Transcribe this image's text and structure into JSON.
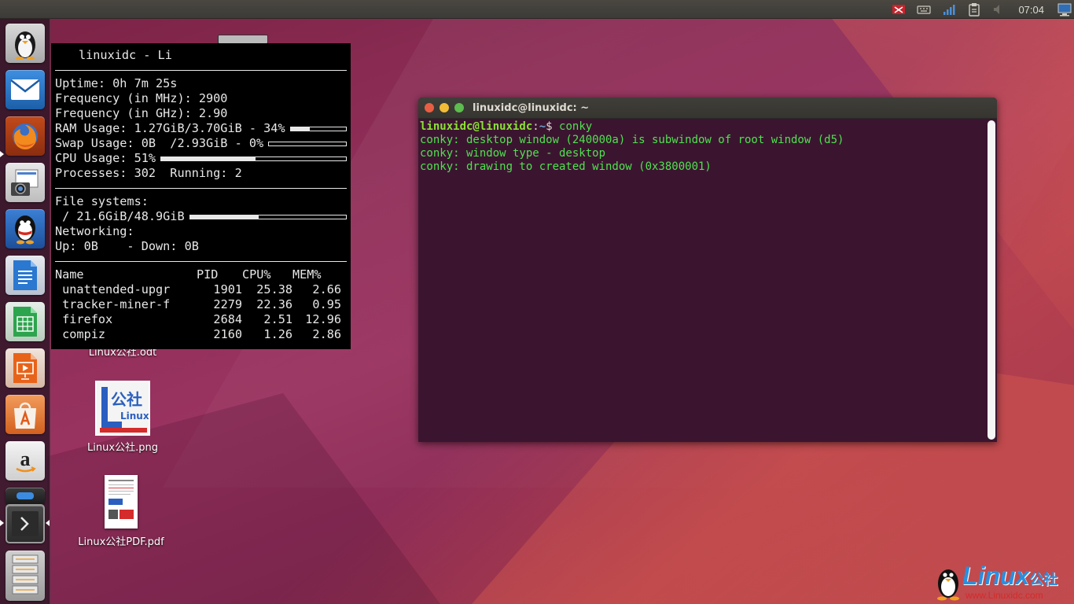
{
  "top_panel": {
    "clock": "07:04",
    "tray_icons": [
      "notification-icon",
      "keyboard-icon",
      "network-icon",
      "clipboard-icon",
      "volume-icon",
      "session-icon"
    ]
  },
  "launcher": {
    "items": [
      {
        "name": "qq-penguin",
        "label": "QQ"
      },
      {
        "name": "mail",
        "label": "Mail"
      },
      {
        "name": "firefox",
        "label": "Firefox"
      },
      {
        "name": "screenshot",
        "label": "Screenshot"
      },
      {
        "name": "qq",
        "label": "QQ"
      },
      {
        "name": "writer",
        "label": "Writer"
      },
      {
        "name": "calc",
        "label": "Calc"
      },
      {
        "name": "impress",
        "label": "Impress"
      },
      {
        "name": "software-center",
        "label": "Software"
      },
      {
        "name": "amazon",
        "label": "Amazon"
      },
      {
        "name": "drive",
        "label": "Drive"
      },
      {
        "name": "terminal",
        "label": "Terminal"
      },
      {
        "name": "workspaces",
        "label": "Workspaces"
      }
    ]
  },
  "conky": {
    "title": "linuxidc - Li",
    "uptime": "Uptime: 0h 7m 25s",
    "freq_mhz": "Frequency (in MHz): 2900",
    "freq_ghz": "Frequency (in GHz): 2.90",
    "ram": "RAM Usage: 1.27GiB/3.70GiB - 34%",
    "ram_pct": 34,
    "swap": "Swap Usage: 0B  /2.93GiB - 0%",
    "swap_pct": 0,
    "cpu": "CPU Usage: 51%",
    "cpu_pct": 51,
    "processes": "Processes: 302  Running: 2",
    "fs_header": "File systems:",
    "fs_root": " / 21.6GiB/48.9GiB",
    "fs_pct": 44,
    "net_header": "Networking:",
    "net": "Up: 0B    - Down: 0B",
    "proc_headers": [
      "Name",
      "PID",
      "CPU%",
      "MEM%"
    ],
    "procs": [
      {
        "name": " unattended-upgr",
        "pid": "1901",
        "cpu": "25.38",
        "mem": "2.66"
      },
      {
        "name": " tracker-miner-f",
        "pid": "2279",
        "cpu": "22.36",
        "mem": "0.95"
      },
      {
        "name": " firefox",
        "pid": "2684",
        "cpu": "2.51",
        "mem": "12.96"
      },
      {
        "name": " compiz",
        "pid": "2160",
        "cpu": "1.26",
        "mem": "2.86"
      }
    ]
  },
  "terminal": {
    "title": "linuxidc@linuxidc: ~",
    "prompt_user": "linuxidc@linuxidc",
    "prompt_sep": ":",
    "prompt_path": "~",
    "prompt_dollar": "$ ",
    "command": "conky",
    "output": [
      "conky: desktop window (240000a) is subwindow of root window (d5)",
      "conky: window type - desktop",
      "conky: drawing to created window (0x3800001)"
    ]
  },
  "desktop": {
    "icons": [
      {
        "label": "Linux公社.odt"
      },
      {
        "label": "Linux公社.png"
      },
      {
        "label": "Linux公社PDF.pdf"
      }
    ],
    "png_logo_text_top": "公社",
    "png_logo_text_bottom": "Linux"
  },
  "watermark": {
    "brand": "Linux",
    "brand_cn": "公社",
    "url": "www.Linuxidc.com"
  }
}
